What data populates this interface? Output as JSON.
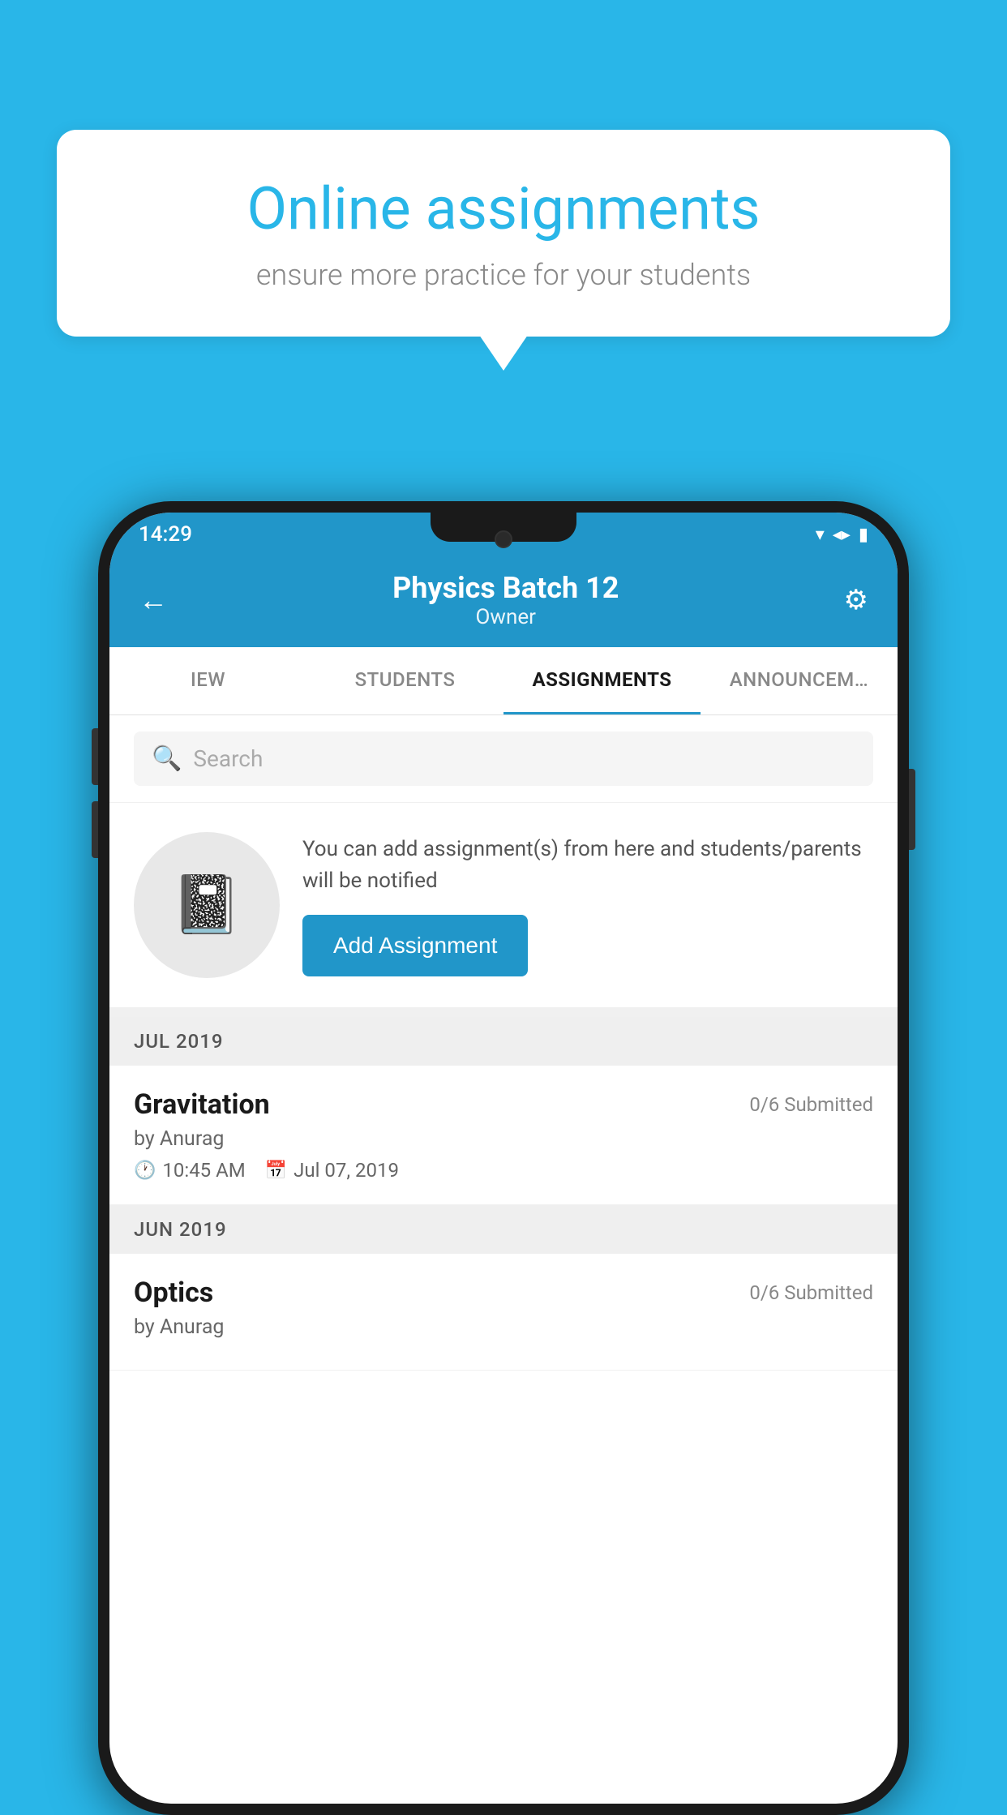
{
  "background_color": "#29b6e8",
  "speech_bubble": {
    "title": "Online assignments",
    "subtitle": "ensure more practice for your students"
  },
  "phone": {
    "status_bar": {
      "time": "14:29",
      "wifi": "▼",
      "signal": "▲",
      "battery": "▮"
    },
    "header": {
      "title": "Physics Batch 12",
      "subtitle": "Owner",
      "back_label": "←",
      "settings_label": "⚙"
    },
    "tabs": [
      {
        "label": "IEW",
        "active": false
      },
      {
        "label": "STUDENTS",
        "active": false
      },
      {
        "label": "ASSIGNMENTS",
        "active": true
      },
      {
        "label": "ANNOUNCEM…",
        "active": false
      }
    ],
    "search": {
      "placeholder": "Search"
    },
    "promo": {
      "text": "You can add assignment(s) from here and students/parents will be notified",
      "button_label": "Add Assignment"
    },
    "sections": [
      {
        "month_label": "JUL 2019",
        "assignments": [
          {
            "name": "Gravitation",
            "submitted": "0/6 Submitted",
            "by": "by Anurag",
            "time": "10:45 AM",
            "date": "Jul 07, 2019"
          }
        ]
      },
      {
        "month_label": "JUN 2019",
        "assignments": [
          {
            "name": "Optics",
            "submitted": "0/6 Submitted",
            "by": "by Anurag",
            "time": "",
            "date": ""
          }
        ]
      }
    ]
  }
}
